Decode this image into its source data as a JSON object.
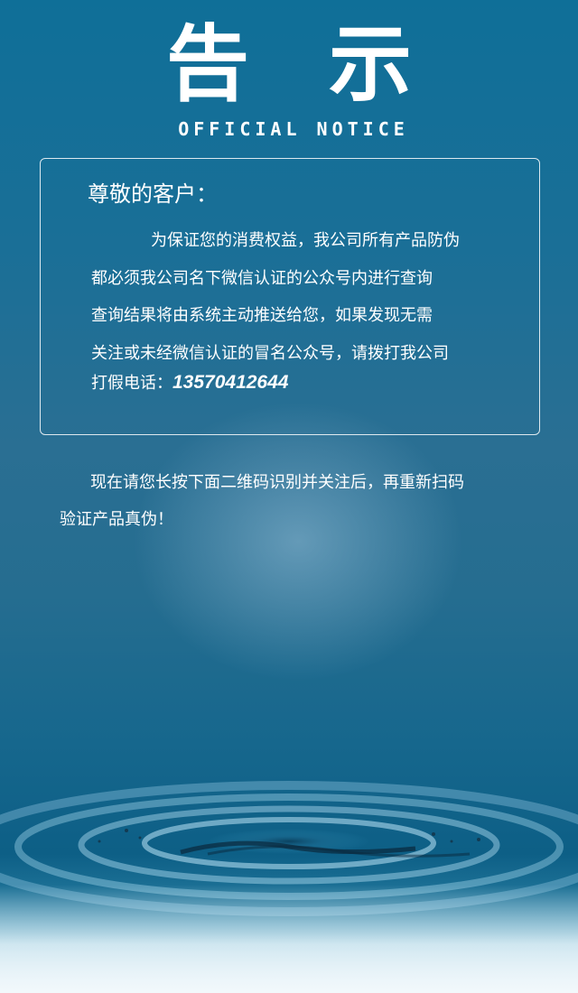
{
  "header": {
    "title": "告 示",
    "subtitle": "OFFICIAL NOTICE"
  },
  "notice": {
    "greeting": "尊敬的客户：",
    "lines": [
      "为保证您的消费权益，我公司所有产品防伪",
      "都必须我公司名下微信认证的公众号内进行查询",
      "查询结果将由系统主动推送给您，如果发现无需",
      "关注或未经微信认证的冒名公众号，请拨打我公司"
    ],
    "phone_label": "打假电话：",
    "phone_number": "13570412644"
  },
  "instruction": {
    "line1": "现在请您长按下面二维码识别并关注后，再重新扫码",
    "line2": "验证产品真伪！"
  },
  "colors": {
    "background_top": "#0f6f98",
    "background_mid": "#2a6f93",
    "text": "#ffffff",
    "box_border": "#ffffff"
  }
}
